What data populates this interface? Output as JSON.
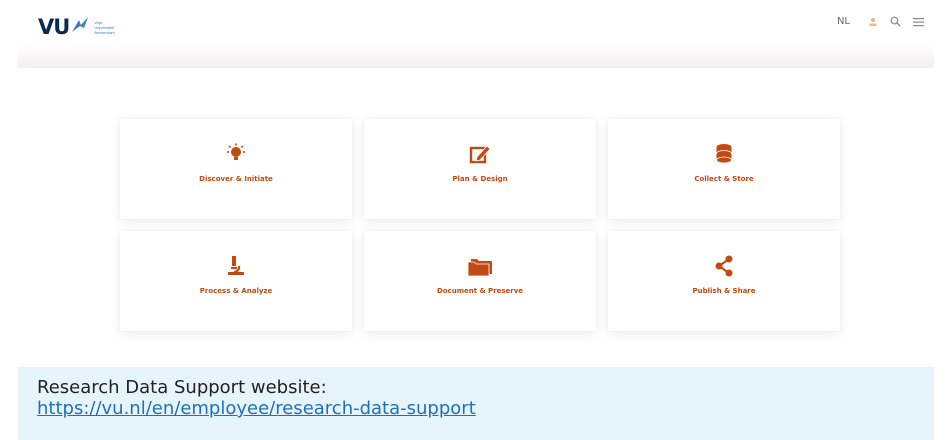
{
  "header": {
    "logo_text": "VU",
    "logo_tagline": [
      "Vrije",
      "Universiteit",
      "Amsterdam"
    ],
    "lang_label": "NL",
    "icons": [
      "user-icon",
      "search-icon",
      "menu-icon"
    ]
  },
  "tiles": [
    {
      "label": "Discover & Initiate",
      "icon": "lightbulb-icon"
    },
    {
      "label": "Plan & Design",
      "icon": "edit-icon"
    },
    {
      "label": "Collect & Store",
      "icon": "database-icon"
    },
    {
      "label": "Process & Analyze",
      "icon": "microscope-icon"
    },
    {
      "label": "Document & Preserve",
      "icon": "folder-icon"
    },
    {
      "label": "Publish & Share",
      "icon": "share-icon"
    }
  ],
  "banner": {
    "text": "Research Data Support website:",
    "link": "https://vu.nl/en/employee/research-data-support"
  },
  "colors": {
    "accent": "#c24a10",
    "brand": "#0a2a56",
    "banner_bg": "#e6f4fb",
    "link": "#1f6fbf"
  }
}
